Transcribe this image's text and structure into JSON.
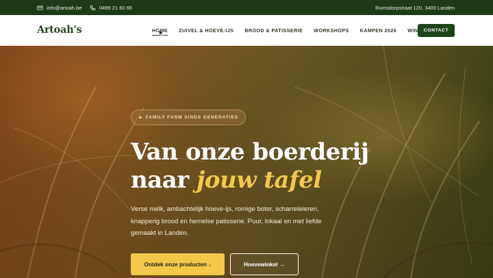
{
  "topbar": {
    "email": "info@artoah.be",
    "phone": "0499 21 60 65",
    "address": "Rumsdorpstraat 120, 3400 Landen"
  },
  "nav": {
    "logo": "Artoah's",
    "links": [
      "HOME",
      "ZUIVEL & HOEVE-IJS",
      "BROOD & PATISSERIE",
      "WORKSHOPS",
      "KAMPEN 2026",
      "WINKEL"
    ],
    "active": "HOME",
    "contact": "CONTACT"
  },
  "hero": {
    "badge": "FAMILY FARM SINDS GENERATIES",
    "headline_line1": "Van onze boerderij",
    "headline_line2_plain": "naar",
    "headline_line2_accent": "jouw tafel",
    "subtext": "Verse melk, ambachtelijk hoeve-ijs, romige boter, scharreleieren, knapperig brood en hemelse patisserie. Puur, lokaal en met liefde gemaakt in Landen.",
    "primary_button": "Ontdek onze producten ↓",
    "secondary_button": "Hoevewinkel →"
  },
  "colors": {
    "topbar_bg": "#1e3a17",
    "brand_green": "#2e4a24",
    "contact_bg": "#1e4419",
    "accent_yellow": "#f2c84a"
  },
  "icons": [
    "mail-icon",
    "phone-icon",
    "sparkle-icon",
    "cursor-icon"
  ]
}
